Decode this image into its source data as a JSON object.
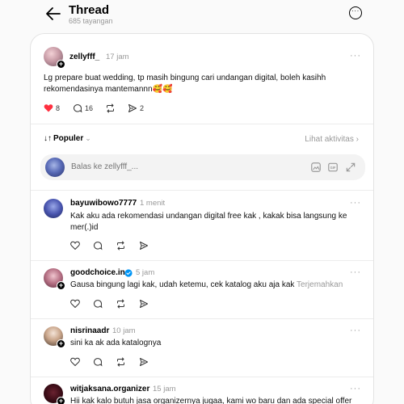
{
  "header": {
    "title": "Thread",
    "subtitle": "685 tayangan"
  },
  "post": {
    "username": "zellyfff_",
    "time": "17 jam",
    "text": "Lg prepare buat wedding, tp masih bingung cari undangan digital, boleh kasihh rekomendasinya mantemannn🥰🥰",
    "likes": "8",
    "comments": "16",
    "shares": "2"
  },
  "sort": {
    "label": "Populer",
    "activity": "Lihat aktivitas"
  },
  "reply": {
    "placeholder": "Balas ke zellyfff_..."
  },
  "comments": [
    {
      "username": "bayuwibowo7777",
      "time": "1 menit",
      "text": "Kak aku ada rekomendasi undangan digital free kak , kakak bisa langsung ke mer(.)id",
      "translate": ""
    },
    {
      "username": "goodchoice.in",
      "time": "5 jam",
      "text": "Gausa bingung lagi kak, udah ketemu, cek katalog aku aja kak",
      "translate": "Terjemahkan",
      "verified": true
    },
    {
      "username": "nisrinaadr",
      "time": "10 jam",
      "text": "sini ka ak ada katalognya",
      "translate": ""
    },
    {
      "username": "witjaksana.organizer",
      "time": "15 jam",
      "text": "Hii kak kalo butuh jasa organizernya jugaa, kami wo baru dan ada special offer",
      "translate": ""
    }
  ],
  "colors": {
    "like_red": "#ff3040",
    "verified_blue": "#0095f6",
    "muted": "#999999"
  }
}
